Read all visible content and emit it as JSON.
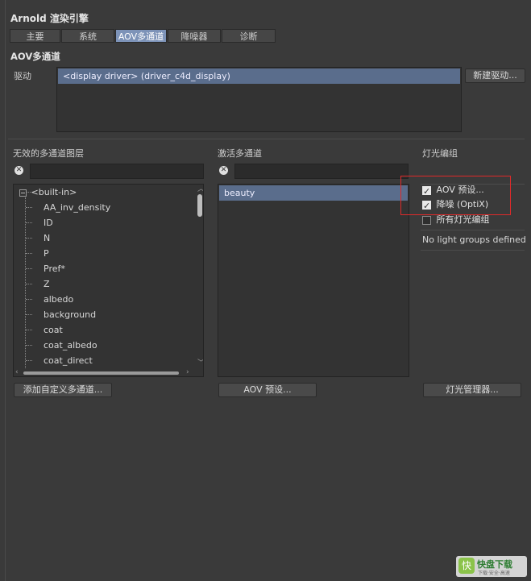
{
  "window": {
    "title": "Arnold 渲染引擎"
  },
  "tabs": [
    {
      "label": "主要",
      "active": false
    },
    {
      "label": "系统",
      "active": false
    },
    {
      "label": "AOV多通道",
      "active": true
    },
    {
      "label": "降噪器",
      "active": false
    },
    {
      "label": "诊断",
      "active": false
    }
  ],
  "section": {
    "title": "AOV多通道"
  },
  "driver": {
    "label": "驱动",
    "selected": "<display driver> (driver_c4d_display)",
    "new_button": "新建驱动..."
  },
  "inactive": {
    "header": "无效的多通道图层",
    "search_value": "",
    "root": "<built-in>",
    "items": [
      "AA_inv_density",
      "ID",
      "N",
      "P",
      "Pref*",
      "Z",
      "albedo",
      "background",
      "coat",
      "coat_albedo",
      "coat_direct"
    ],
    "add_button": "添加自定义多通道..."
  },
  "active": {
    "header": "激活多通道",
    "search_value": "",
    "items": [
      "beauty"
    ],
    "preset_button": "AOV 预设..."
  },
  "light_groups": {
    "header": "灯光编组",
    "checkboxes": [
      {
        "label": "AOV 预设...",
        "checked": true
      },
      {
        "label": "降噪 (OptiX)",
        "checked": true
      },
      {
        "label": "所有灯光编组",
        "checked": false
      }
    ],
    "empty_text": "No light groups defined",
    "manager_button": "灯光管理器..."
  },
  "watermark": {
    "text": "快盘下载",
    "sub": "下载·安全·高速"
  },
  "colors": {
    "accent": "#7d93b8",
    "highlight": "#e02a2a",
    "selection": "#5a6d8c"
  }
}
